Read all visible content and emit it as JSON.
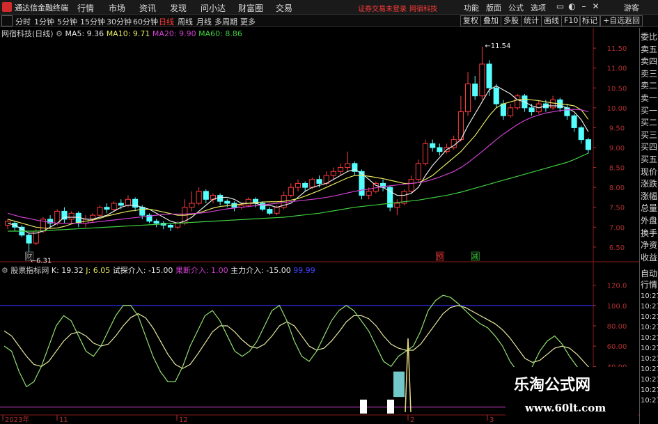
{
  "titlebar": {
    "app_name": "通达信金融终端",
    "menus": [
      "行情",
      "市场",
      "资讯",
      "发现",
      "问小达",
      "财富圈",
      "交易"
    ],
    "alert": "证券交易未登录",
    "stock_tag": "网宿科技",
    "right_menus": [
      "功能",
      "版面",
      "公式",
      "选项"
    ],
    "user": "游客"
  },
  "periods": [
    "分时",
    "1分钟",
    "5分钟",
    "15分钟",
    "30分钟",
    "60分钟",
    "日线",
    "周线",
    "月线",
    "多周期",
    "更多"
  ],
  "active_period": "日线",
  "tools": [
    "复权",
    "叠加",
    "多股",
    "统计",
    "画线",
    "F10",
    "标记",
    "+自选",
    "返回"
  ],
  "stock": {
    "name": "网宿科技(日线)",
    "ma": [
      {
        "label": "MA5: 9.36",
        "color": "#e8e8e8"
      },
      {
        "label": "MA10: 9.71",
        "color": "#e8e860"
      },
      {
        "label": "MA20: 9.90",
        "color": "#d040d0"
      },
      {
        "label": "MA60: 8.86",
        "color": "#40d040"
      }
    ],
    "high_label": "11.54",
    "low_label": "6.31",
    "marks": [
      {
        "text": "财",
        "color": "#aaaaaa"
      },
      {
        "text": "预",
        "color": "#ff3a3a"
      },
      {
        "text": "减",
        "color": "#40d040"
      }
    ]
  },
  "price_axis": [
    "11.50",
    "11.00",
    "10.50",
    "10.00",
    "9.50",
    "9.00",
    "8.50",
    "8.00",
    "7.50",
    "7.00",
    "6.50"
  ],
  "indicator": {
    "name": "股票指标网",
    "k": "K: 19.32",
    "j": "J: 6.05",
    "probe": "试探介入: -15.00",
    "fall": "果断介入: 1.00",
    "main": "主力介入: -15.00",
    "extra": "99.99"
  },
  "ind_axis": [
    "120.0",
    "100.0",
    "80.00",
    "60.00",
    "40.00"
  ],
  "date_axis": [
    "2023年",
    "11",
    "12",
    "2",
    "3"
  ],
  "right_panel": {
    "items": [
      "委比",
      "卖五",
      "卖四",
      "卖三",
      "卖二",
      "卖一",
      "买一",
      "买二",
      "买三",
      "买四",
      "买五",
      "现价",
      "涨跌",
      "涨幅",
      "总量",
      "外盘",
      "换手",
      "净资",
      "收益",
      "自动",
      "行情"
    ],
    "times": [
      "10:27",
      "10:27",
      "10:27",
      "10:27",
      "10:27",
      "10:27",
      "10:27",
      "10:27",
      "10:27",
      "10:27",
      "10:27"
    ]
  },
  "watermark": {
    "title": "乐淘公式网",
    "url": "www.60lt.com"
  },
  "chart_data": {
    "type": "candlestick",
    "price_range": [
      6.2,
      11.8
    ],
    "candles": [
      [
        7.05,
        7.15,
        6.95,
        7.2
      ],
      [
        7.1,
        7.0,
        6.9,
        7.15
      ],
      [
        7.0,
        6.8,
        6.75,
        7.05
      ],
      [
        6.8,
        6.6,
        6.31,
        6.85
      ],
      [
        6.6,
        6.9,
        6.55,
        6.95
      ],
      [
        6.9,
        7.2,
        6.85,
        7.25
      ],
      [
        7.2,
        7.1,
        7.0,
        7.3
      ],
      [
        7.1,
        7.4,
        7.05,
        7.45
      ],
      [
        7.4,
        7.2,
        7.1,
        7.5
      ],
      [
        7.2,
        7.35,
        7.1,
        7.4
      ],
      [
        7.35,
        7.1,
        7.0,
        7.4
      ],
      [
        7.1,
        7.2,
        7.0,
        7.3
      ],
      [
        7.2,
        7.3,
        7.1,
        7.35
      ],
      [
        7.3,
        7.5,
        7.25,
        7.55
      ],
      [
        7.5,
        7.45,
        7.35,
        7.6
      ],
      [
        7.45,
        7.6,
        7.4,
        7.65
      ],
      [
        7.6,
        7.55,
        7.45,
        7.7
      ],
      [
        7.55,
        7.7,
        7.5,
        7.8
      ],
      [
        7.7,
        7.5,
        7.4,
        7.75
      ],
      [
        7.5,
        7.3,
        7.2,
        7.55
      ],
      [
        7.3,
        7.15,
        7.1,
        7.35
      ],
      [
        7.15,
        7.1,
        7.0,
        7.2
      ],
      [
        7.1,
        7.05,
        6.95,
        7.15
      ],
      [
        7.05,
        7.0,
        6.9,
        7.1
      ],
      [
        7.0,
        7.1,
        6.95,
        7.15
      ],
      [
        7.1,
        7.5,
        7.05,
        7.7
      ],
      [
        7.5,
        7.6,
        7.4,
        7.9
      ],
      [
        7.6,
        7.9,
        7.55,
        8.0
      ],
      [
        7.9,
        7.7,
        7.6,
        7.95
      ],
      [
        7.7,
        7.8,
        7.6,
        7.85
      ],
      [
        7.8,
        7.65,
        7.55,
        7.85
      ],
      [
        7.65,
        7.6,
        7.5,
        7.7
      ],
      [
        7.6,
        7.5,
        7.4,
        7.65
      ],
      [
        7.5,
        7.55,
        7.45,
        7.6
      ],
      [
        7.55,
        7.7,
        7.5,
        7.75
      ],
      [
        7.7,
        7.6,
        7.5,
        7.75
      ],
      [
        7.6,
        7.45,
        7.4,
        7.65
      ],
      [
        7.45,
        7.35,
        7.3,
        7.5
      ],
      [
        7.35,
        7.5,
        7.3,
        7.55
      ],
      [
        7.5,
        7.8,
        7.45,
        7.9
      ],
      [
        7.8,
        8.0,
        7.75,
        8.1
      ],
      [
        8.0,
        8.1,
        7.9,
        8.2
      ],
      [
        8.1,
        8.0,
        7.9,
        8.15
      ],
      [
        8.0,
        8.2,
        7.95,
        8.25
      ],
      [
        8.2,
        8.1,
        8.0,
        8.3
      ],
      [
        8.1,
        8.3,
        8.05,
        8.4
      ],
      [
        8.3,
        8.4,
        8.2,
        8.5
      ],
      [
        8.4,
        8.5,
        8.3,
        8.6
      ],
      [
        8.5,
        8.6,
        8.4,
        8.9
      ],
      [
        8.6,
        8.4,
        8.3,
        8.65
      ],
      [
        8.4,
        7.8,
        7.7,
        8.45
      ],
      [
        7.8,
        7.9,
        7.7,
        8.0
      ],
      [
        7.9,
        8.1,
        7.85,
        8.15
      ],
      [
        8.1,
        8.0,
        7.9,
        8.2
      ],
      [
        8.0,
        7.5,
        7.4,
        8.05
      ],
      [
        7.5,
        7.6,
        7.3,
        7.7
      ],
      [
        7.6,
        7.9,
        7.55,
        7.95
      ],
      [
        7.9,
        8.2,
        7.85,
        8.3
      ],
      [
        8.2,
        8.6,
        8.15,
        8.7
      ],
      [
        8.6,
        9.1,
        8.55,
        9.2
      ],
      [
        9.1,
        9.0,
        8.9,
        9.2
      ],
      [
        9.0,
        8.9,
        8.8,
        9.1
      ],
      [
        8.9,
        9.0,
        8.85,
        9.1
      ],
      [
        9.0,
        9.2,
        8.95,
        9.3
      ],
      [
        9.2,
        9.9,
        9.15,
        10.3
      ],
      [
        9.9,
        10.6,
        9.8,
        10.9
      ],
      [
        10.6,
        10.3,
        10.2,
        10.8
      ],
      [
        10.3,
        11.1,
        10.2,
        11.54
      ],
      [
        11.1,
        10.5,
        10.3,
        11.2
      ],
      [
        10.5,
        10.1,
        10.0,
        10.6
      ],
      [
        10.1,
        9.8,
        9.7,
        10.2
      ],
      [
        9.8,
        10.0,
        9.75,
        10.1
      ],
      [
        10.0,
        10.3,
        9.95,
        10.35
      ],
      [
        10.3,
        10.0,
        9.9,
        10.35
      ],
      [
        10.0,
        9.9,
        9.8,
        10.1
      ],
      [
        9.9,
        10.1,
        9.85,
        10.2
      ],
      [
        10.1,
        10.0,
        9.9,
        10.2
      ],
      [
        10.0,
        10.2,
        9.95,
        10.3
      ],
      [
        10.2,
        10.0,
        9.9,
        10.25
      ],
      [
        10.0,
        9.8,
        9.7,
        10.1
      ],
      [
        9.8,
        9.5,
        9.4,
        9.85
      ],
      [
        9.5,
        9.2,
        9.1,
        9.55
      ],
      [
        9.2,
        8.95,
        8.85,
        9.25
      ]
    ],
    "ma5": [
      7.1,
      7.05,
      6.95,
      6.85,
      6.85,
      6.9,
      7.0,
      7.1,
      7.25,
      7.25,
      7.25,
      7.2,
      7.2,
      7.25,
      7.3,
      7.4,
      7.5,
      7.55,
      7.55,
      7.5,
      7.45,
      7.35,
      7.25,
      7.15,
      7.1,
      7.15,
      7.25,
      7.4,
      7.55,
      7.7,
      7.75,
      7.75,
      7.7,
      7.6,
      7.6,
      7.6,
      7.55,
      7.55,
      7.5,
      7.55,
      7.6,
      7.75,
      7.9,
      8.0,
      8.05,
      8.1,
      8.2,
      8.3,
      8.4,
      8.45,
      8.35,
      8.2,
      8.05,
      8.0,
      7.9,
      7.8,
      7.8,
      7.85,
      8.0,
      8.3,
      8.55,
      8.75,
      8.95,
      9.05,
      9.2,
      9.55,
      9.85,
      10.15,
      10.45,
      10.55,
      10.45,
      10.35,
      10.2,
      10.15,
      10.05,
      10.0,
      10.05,
      10.05,
      10.05,
      10.0,
      9.9,
      9.7,
      9.4
    ],
    "ma10": [
      7.2,
      7.15,
      7.1,
      7.05,
      7.0,
      6.98,
      6.97,
      6.98,
      7.02,
      7.08,
      7.12,
      7.15,
      7.18,
      7.22,
      7.28,
      7.32,
      7.36,
      7.4,
      7.42,
      7.45,
      7.45,
      7.42,
      7.38,
      7.34,
      7.3,
      7.3,
      7.32,
      7.36,
      7.42,
      7.48,
      7.52,
      7.54,
      7.56,
      7.58,
      7.6,
      7.62,
      7.63,
      7.64,
      7.64,
      7.65,
      7.68,
      7.72,
      7.78,
      7.85,
      7.92,
      8.0,
      8.08,
      8.16,
      8.24,
      8.3,
      8.3,
      8.28,
      8.25,
      8.22,
      8.18,
      8.14,
      8.1,
      8.1,
      8.12,
      8.2,
      8.3,
      8.45,
      8.6,
      8.75,
      8.9,
      9.1,
      9.3,
      9.55,
      9.8,
      10.0,
      10.1,
      10.15,
      10.2,
      10.22,
      10.2,
      10.18,
      10.15,
      10.12,
      10.1,
      10.08,
      10.05,
      9.95,
      9.71
    ],
    "ma20": [
      7.35,
      7.3,
      7.25,
      7.22,
      7.18,
      7.15,
      7.12,
      7.1,
      7.1,
      7.1,
      7.1,
      7.1,
      7.12,
      7.14,
      7.16,
      7.18,
      7.2,
      7.22,
      7.24,
      7.26,
      7.28,
      7.3,
      7.32,
      7.33,
      7.33,
      7.33,
      7.34,
      7.35,
      7.37,
      7.4,
      7.43,
      7.46,
      7.48,
      7.5,
      7.52,
      7.54,
      7.56,
      7.58,
      7.6,
      7.62,
      7.64,
      7.66,
      7.68,
      7.7,
      7.72,
      7.75,
      7.78,
      7.82,
      7.86,
      7.9,
      7.93,
      7.96,
      7.99,
      8.02,
      8.04,
      8.06,
      8.08,
      8.1,
      8.12,
      8.15,
      8.2,
      8.26,
      8.33,
      8.4,
      8.5,
      8.62,
      8.76,
      8.9,
      9.05,
      9.2,
      9.34,
      9.46,
      9.58,
      9.68,
      9.76,
      9.82,
      9.87,
      9.9,
      9.93,
      9.95,
      9.96,
      9.95,
      9.9
    ],
    "ma60": [
      6.9,
      6.9,
      6.9,
      6.9,
      6.9,
      6.91,
      6.92,
      6.93,
      6.94,
      6.95,
      6.96,
      6.97,
      6.98,
      6.99,
      7.0,
      7.01,
      7.02,
      7.03,
      7.04,
      7.05,
      7.06,
      7.07,
      7.08,
      7.09,
      7.1,
      7.11,
      7.12,
      7.13,
      7.14,
      7.15,
      7.16,
      7.17,
      7.18,
      7.19,
      7.2,
      7.21,
      7.22,
      7.23,
      7.24,
      7.25,
      7.27,
      7.29,
      7.31,
      7.33,
      7.35,
      7.38,
      7.41,
      7.44,
      7.47,
      7.5,
      7.52,
      7.54,
      7.56,
      7.58,
      7.6,
      7.62,
      7.64,
      7.66,
      7.68,
      7.71,
      7.74,
      7.77,
      7.8,
      7.84,
      7.88,
      7.93,
      7.98,
      8.03,
      8.08,
      8.13,
      8.18,
      8.23,
      8.28,
      8.33,
      8.38,
      8.43,
      8.48,
      8.53,
      8.58,
      8.63,
      8.7,
      8.78,
      8.86
    ],
    "ind_range": [
      -5,
      130
    ],
    "k_line": [
      60,
      55,
      35,
      20,
      25,
      40,
      60,
      80,
      90,
      85,
      70,
      55,
      50,
      60,
      75,
      90,
      100,
      100,
      90,
      70,
      50,
      35,
      25,
      25,
      40,
      60,
      75,
      90,
      95,
      85,
      70,
      55,
      50,
      55,
      65,
      80,
      95,
      100,
      85,
      65,
      50,
      45,
      55,
      70,
      85,
      95,
      100,
      95,
      85,
      75,
      60,
      45,
      40,
      50,
      55,
      60,
      75,
      95,
      105,
      110,
      108,
      102,
      95,
      88,
      82,
      78,
      70,
      60,
      45,
      35,
      30,
      40,
      55,
      65,
      70,
      62,
      50,
      40,
      30,
      25
    ],
    "d_line": [
      75,
      70,
      60,
      50,
      42,
      40,
      45,
      55,
      65,
      72,
      74,
      70,
      63,
      60,
      62,
      70,
      80,
      88,
      92,
      88,
      78,
      65,
      52,
      42,
      38,
      42,
      52,
      63,
      74,
      80,
      80,
      74,
      66,
      60,
      58,
      62,
      70,
      80,
      84,
      80,
      70,
      60,
      56,
      58,
      65,
      74,
      84,
      90,
      90,
      87,
      80,
      70,
      62,
      58,
      56,
      56,
      62,
      72,
      82,
      92,
      98,
      100,
      98,
      94,
      90,
      86,
      82,
      76,
      68,
      58,
      48,
      44,
      46,
      52,
      58,
      60,
      58,
      52,
      44,
      36
    ],
    "ref_lines": [
      100,
      0
    ]
  }
}
